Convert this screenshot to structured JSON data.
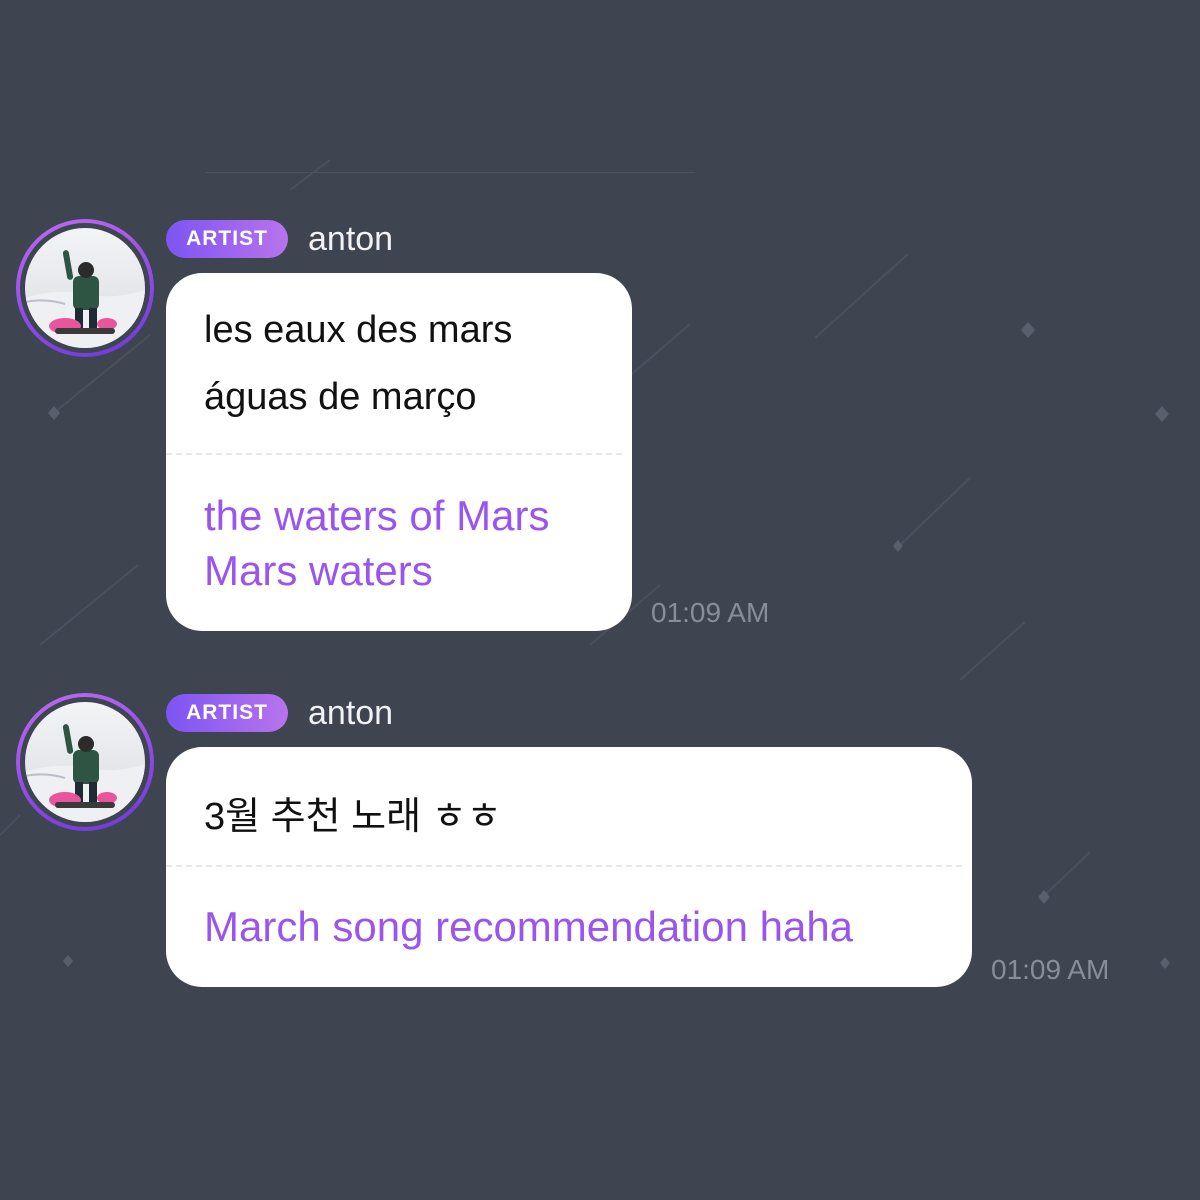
{
  "messages": [
    {
      "badge": "ARTIST",
      "author": "anton",
      "original_lines": [
        "les eaux des mars",
        "águas de março"
      ],
      "translation_lines": [
        "the waters of Mars",
        "Mars waters"
      ],
      "time": "01:09 AM"
    },
    {
      "badge": "ARTIST",
      "author": "anton",
      "original_lines": [
        "3월 추천 노래 ㅎㅎ"
      ],
      "translation_lines": [
        "March song recommendation haha"
      ],
      "time": "01:09 AM"
    }
  ],
  "colors": {
    "background": "#3f4451",
    "badge_gradient_start": "#7d55f2",
    "badge_gradient_end": "#b873ec",
    "translation_text": "#9a55ee",
    "bubble": "#ffffff",
    "timestamp": "#888d9a",
    "avatar_ring": "#9b55ea"
  },
  "icons": {
    "avatar": "profile-photo",
    "background_pattern": "shooting-star-diamond"
  }
}
